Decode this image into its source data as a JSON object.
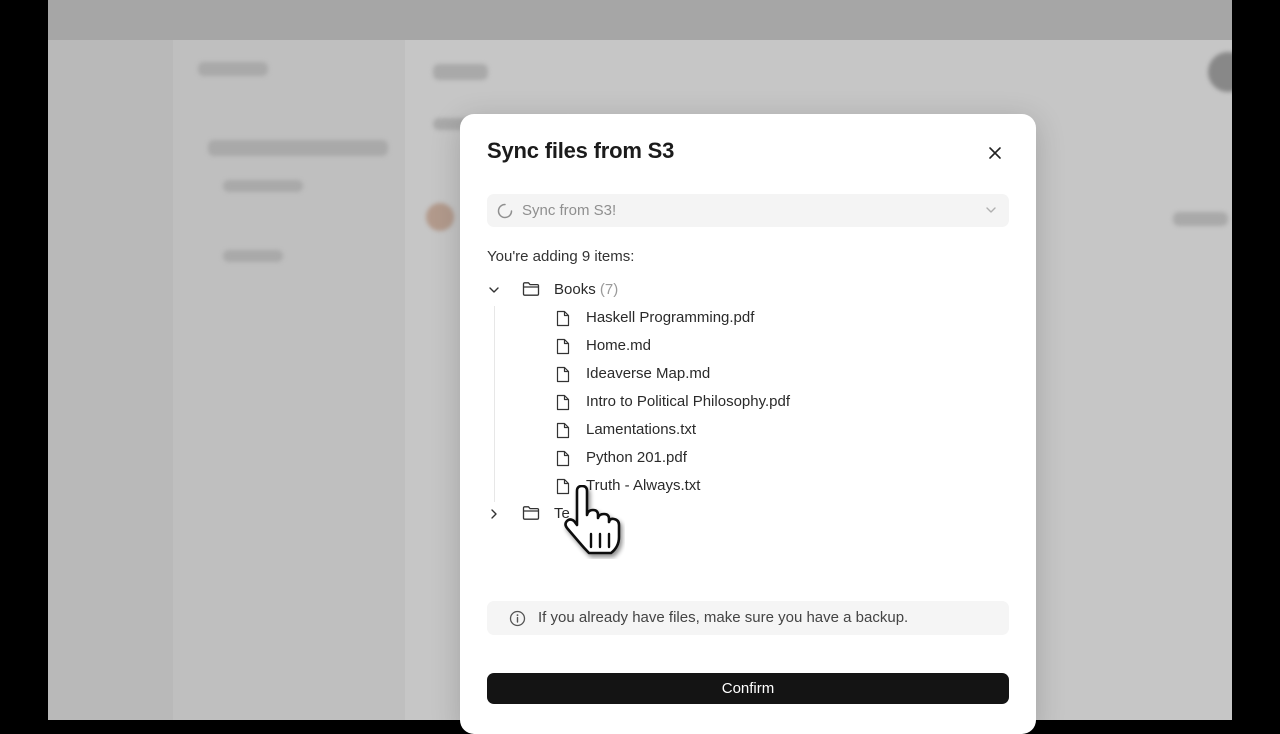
{
  "dialog": {
    "title": "Sync files from S3",
    "source_select": {
      "value": "Sync from S3!"
    },
    "summary": "You're adding 9 items:",
    "tree": [
      {
        "name": "Books",
        "count": "(7)",
        "expanded": true,
        "files": [
          "Haskell Programming.pdf",
          "Home.md",
          "Ideaverse Map.md",
          "Intro to Political Philosophy.pdf",
          "Lamentations.txt",
          "Python 201.pdf",
          "Truth - Always.txt"
        ]
      },
      {
        "name": "Te",
        "expanded": false
      }
    ],
    "info_note": "If you already have files, make sure you have a backup.",
    "confirm_label": "Confirm"
  },
  "icons": {
    "close": "close-icon",
    "select": "loading-spinner-icon",
    "chevron": "chevron-down-icon",
    "folder": "folder-icon",
    "file": "file-icon",
    "info": "info-icon",
    "cursor": "hand-pointer-cursor"
  },
  "colors": {
    "confirm_bg": "#141414",
    "backdrop": "#b9b9b9"
  }
}
